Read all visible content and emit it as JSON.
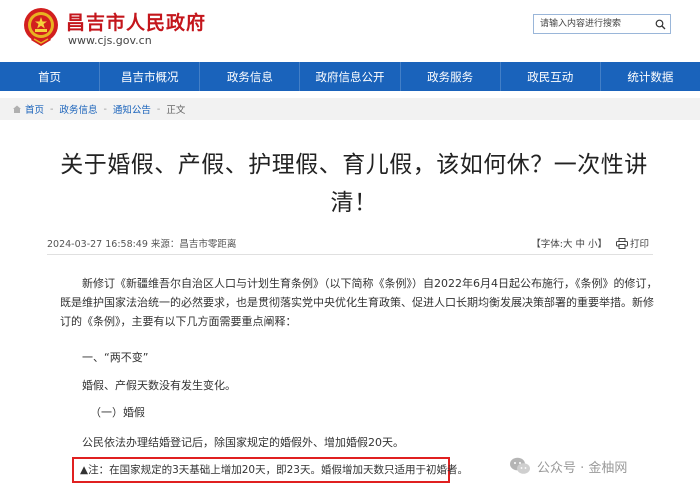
{
  "header": {
    "site_name": "昌吉市人民政府",
    "site_url": "www.cjs.gov.cn",
    "search_placeholder": "请输入内容进行搜索"
  },
  "nav": {
    "items": [
      "首页",
      "昌吉市概况",
      "政务信息",
      "政府信息公开",
      "政务服务",
      "政民互动",
      "统计数据"
    ]
  },
  "breadcrumb": {
    "items": [
      "首页",
      "政务信息",
      "通知公告",
      "正文"
    ]
  },
  "article": {
    "title_line1": "关于婚假、产假、护理假、育儿假，该如何休？一次性讲",
    "title_line2": "清！",
    "meta": "2024-03-27 16:58:49 来源：昌吉市零距离",
    "font_label": "【字体:大",
    "font_medium": "中",
    "font_small": "小】",
    "print_label": "打印",
    "p1": "新修订《新疆维吾尔自治区人口与计划生育条例》（以下简称《条例》）自2022年6月4日起公布施行，《条例》的修订，既是维护国家法治统一的必然要求，也是贯彻落实党中央优化生育政策、促进人口长期均衡发展决策部署的重要举措。新修订的《条例》，主要有以下几方面需要重点阐释：",
    "l2": "一、“两不变”",
    "l3": "婚假、产假天数没有发生变化。",
    "l4": "（一）婚假",
    "l5": "公民依法办理结婚登记后，除国家规定的婚假外、增加婚假20天。",
    "note": "▲注：在国家规定的3天基础上增加20天，即23天。婚假增加天数只适用于初婚者。"
  },
  "watermark": {
    "text": "公众号 · 金柚网"
  },
  "colors": {
    "brand_red": "#c4161c",
    "nav_blue": "#1a63bb",
    "highlight_red": "#e02020"
  }
}
